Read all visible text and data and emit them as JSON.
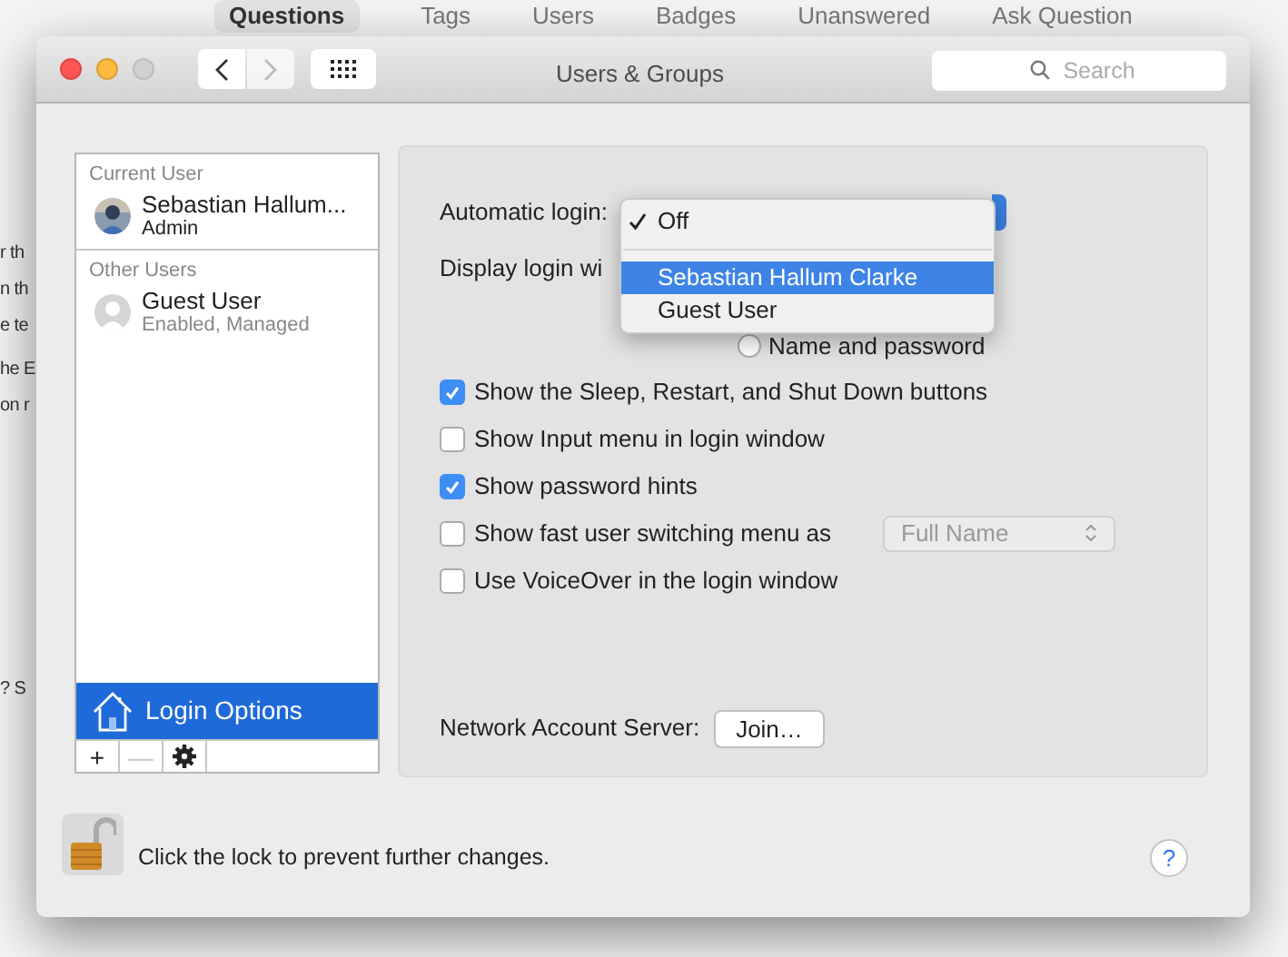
{
  "background_page": {
    "tabs": [
      {
        "label": "Questions",
        "selected": true
      },
      {
        "label": "Tags",
        "selected": false
      },
      {
        "label": "Users",
        "selected": false
      },
      {
        "label": "Badges",
        "selected": false
      },
      {
        "label": "Unanswered",
        "selected": false
      },
      {
        "label": "Ask Question",
        "selected": false
      }
    ],
    "text_fragments": [
      "r th",
      "n th",
      "e te",
      "he E",
      "on r",
      "? S"
    ]
  },
  "window": {
    "title": "Users & Groups",
    "search": {
      "placeholder": "Search"
    }
  },
  "sidebar": {
    "sections": [
      {
        "heading": "Current User",
        "users": [
          {
            "name": "Sebastian Hallum...",
            "detail": "Admin",
            "kind": "photo"
          }
        ]
      },
      {
        "heading": "Other Users",
        "users": [
          {
            "name": "Guest User",
            "detail": "Enabled, Managed",
            "kind": "generic"
          }
        ]
      }
    ],
    "login_options": {
      "label": "Login Options",
      "selected": true
    },
    "buttons": [
      {
        "label": "+",
        "disabled": false
      },
      {
        "label": "—",
        "disabled": true
      }
    ]
  },
  "settings": {
    "automatic_login_label": "Automatic login:",
    "display_login_label": "Display login wi",
    "radio_option": {
      "label": "Name and password",
      "selected": false
    },
    "checkboxes": [
      {
        "label": "Show the Sleep, Restart, and Shut Down buttons",
        "checked": true
      },
      {
        "label": "Show Input menu in login window",
        "checked": false
      },
      {
        "label": "Show password hints",
        "checked": true
      },
      {
        "label": "Show fast user switching menu as",
        "checked": false
      },
      {
        "label": "Use VoiceOver in the login window",
        "checked": false
      }
    ],
    "switching_menu": {
      "value": "Full Name",
      "disabled": true
    },
    "network_label": "Network Account Server:",
    "join_button": "Join…"
  },
  "menu": {
    "items": [
      {
        "label": "Off",
        "checked": true,
        "selected": false
      },
      {
        "label": "Sebastian Hallum Clarke",
        "checked": false,
        "selected": true
      },
      {
        "label": "Guest User",
        "checked": false,
        "selected": false
      }
    ]
  },
  "lock": {
    "locked": false,
    "message": "Click the lock to prevent further changes."
  },
  "help_button": "?"
}
